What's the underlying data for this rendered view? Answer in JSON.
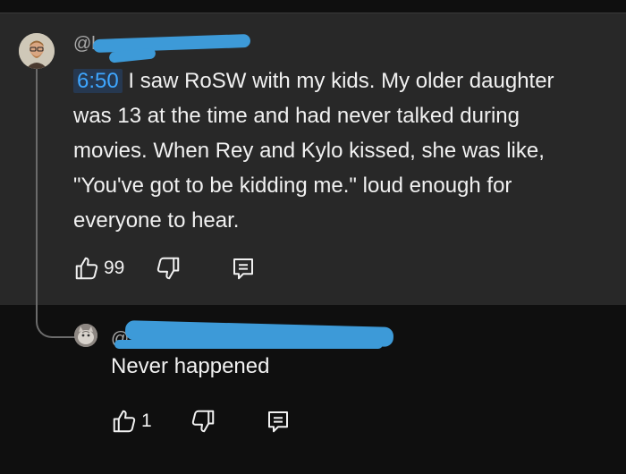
{
  "comment": {
    "handle": "@l",
    "timestamp_link": "6:50",
    "text": " I saw RoSW with my kids.  My older daughter was 13 at the time and had never talked during movies.  When Rey and Kylo kissed, she was like, \"You've got to be kidding me.\" loud enough for everyone to hear.",
    "like_count": "99"
  },
  "reply": {
    "handle": "@",
    "text": "Never happened",
    "like_count": "1"
  },
  "icons": [
    "thumbs-up-icon",
    "thumbs-down-icon",
    "reply-icon"
  ],
  "colors": {
    "background": "#0f0f0f",
    "highlight": "#282828",
    "link": "#3ea6ff",
    "redaction": "#3d9ad8"
  }
}
